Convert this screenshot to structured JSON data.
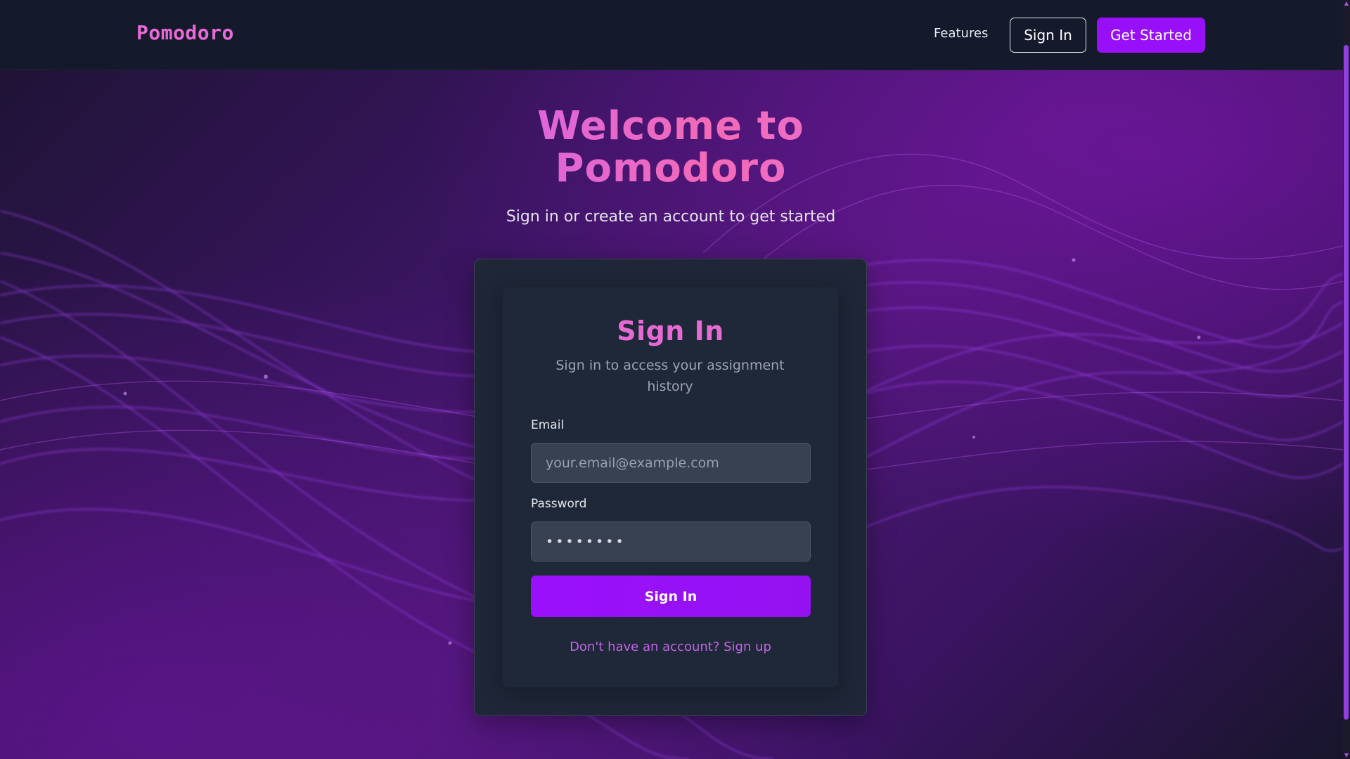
{
  "header": {
    "brand": "Pomodoro",
    "nav_features": "Features",
    "sign_in_label": "Sign In",
    "get_started_label": "Get Started"
  },
  "hero": {
    "title_line1": "Welcome to",
    "title_line2": "Pomodoro",
    "subtitle": "Sign in or create an account to get started"
  },
  "signin_card": {
    "title": "Sign In",
    "subtitle": "Sign in to access your assignment history",
    "email_label": "Email",
    "email_placeholder": "your.email@example.com",
    "password_label": "Password",
    "password_value": "••••••••",
    "submit_label": "Sign In",
    "signup_link": "Don't have an account? Sign up"
  },
  "colors": {
    "accent_purple": "#9810fa",
    "heading_pink": "#e66ad3",
    "card_bg": "#1f2838",
    "header_bg": "#141a2b"
  },
  "icons": {
    "scroll_up": "triangle-up-icon",
    "scroll_down": "triangle-down-icon"
  }
}
